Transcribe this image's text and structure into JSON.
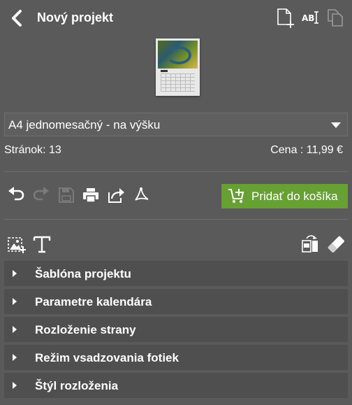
{
  "header": {
    "title": "Nový projekt",
    "icons": [
      "back-arrow-icon",
      "new-page-icon",
      "text-field-icon",
      "duplicate-page-icon"
    ]
  },
  "product": {
    "format_selected": "A4 jednomesačný - na výšku",
    "pages": "Stránok: 13",
    "price": "Cena : 11,99 €"
  },
  "toolbar": {
    "icons": [
      "undo-icon",
      "redo-icon",
      "save-icon",
      "print-icon",
      "share-icon",
      "pdf-icon"
    ],
    "cart_label": "Pridať do košíka",
    "colors": {
      "cart_bg": "#67a033"
    }
  },
  "insert_tools": {
    "icons": [
      "add-image-icon",
      "add-text-icon",
      "replace-layout-icon",
      "eraser-icon"
    ]
  },
  "accordion": [
    {
      "label": "Šablóna projektu"
    },
    {
      "label": "Parametre kalendára"
    },
    {
      "label": "Rozloženie strany"
    },
    {
      "label": "Režim vsadzovania fotiek"
    },
    {
      "label": "Štýl rozloženia"
    }
  ],
  "colors": {
    "background": "#5a5a5a",
    "panel": "#4f4f4f"
  }
}
